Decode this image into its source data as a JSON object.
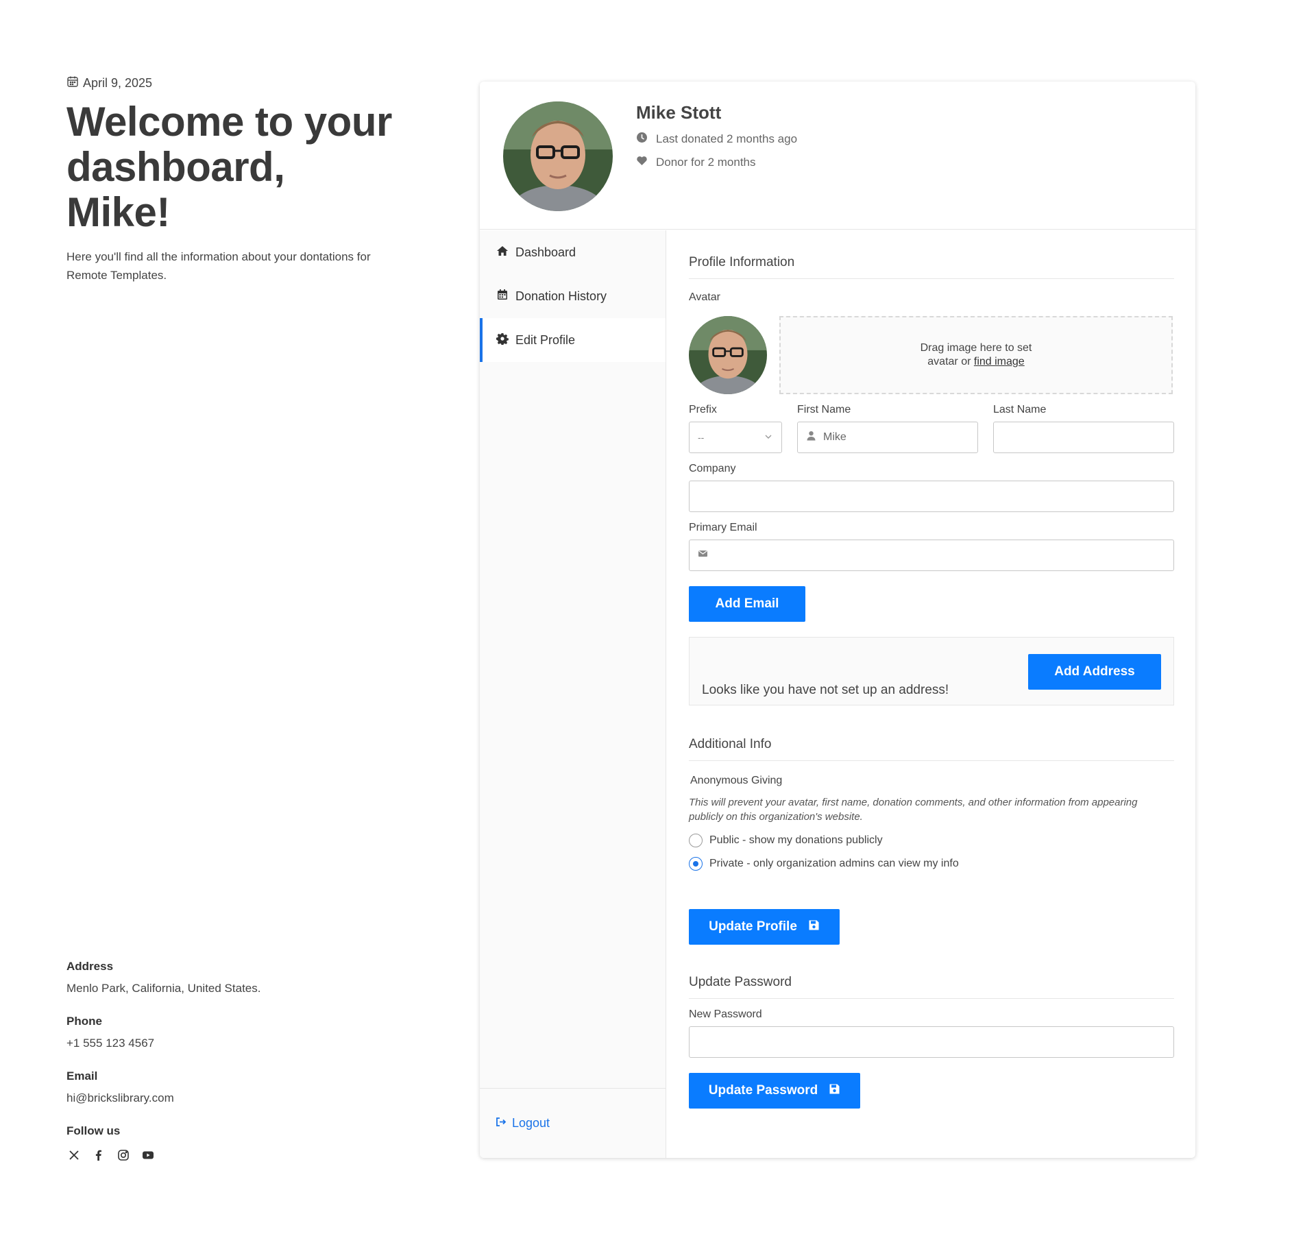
{
  "page": {
    "date": "April 9, 2025",
    "welcome_title": "Welcome to your dashboard, Mike!",
    "intro": "Here you'll find all the information about your dontations for Remote Templates."
  },
  "contact": {
    "address_label": "Address",
    "address_value": "Menlo Park, California, United States.",
    "phone_label": "Phone",
    "phone_value": "+1 555 123 4567",
    "email_label": "Email",
    "email_value": "hi@brickslibrary.com",
    "follow_label": "Follow us",
    "social_icons": [
      "x-icon",
      "facebook-icon",
      "instagram-icon",
      "youtube-icon"
    ]
  },
  "profile_header": {
    "name": "Mike Stott",
    "last_donated": "Last donated 2 months ago",
    "donor_for": "Donor for 2 months"
  },
  "sidebar": {
    "items": [
      {
        "label": "Dashboard",
        "icon": "home-icon",
        "active": false
      },
      {
        "label": "Donation History",
        "icon": "calendar-icon",
        "active": false
      },
      {
        "label": "Edit Profile",
        "icon": "gear-icon",
        "active": true
      }
    ],
    "logout_label": "Logout"
  },
  "profile_info": {
    "section_title": "Profile Information",
    "avatar_label": "Avatar",
    "drop_text": "Drag image here to set",
    "drop_text_2": "avatar or",
    "drop_link": "find image",
    "prefix_label": "Prefix",
    "prefix_value": "--",
    "first_name_label": "First Name",
    "first_name_value": "Mike",
    "last_name_label": "Last Name",
    "last_name_value": "",
    "company_label": "Company",
    "company_value": "",
    "email_label": "Primary Email",
    "email_value": "",
    "add_email_label": "Add Email",
    "no_address_text": "Looks like you have not set up an address!",
    "add_address_label": "Add Address"
  },
  "additional_info": {
    "section_title": "Additional Info",
    "anonymous_label": "Anonymous Giving",
    "anonymous_help": "This will prevent your avatar, first name, donation comments, and other information from appearing publicly on this organization's website.",
    "options": [
      {
        "label": "Public - show my donations publicly",
        "checked": false
      },
      {
        "label": "Private - only organization admins can view my info",
        "checked": true
      }
    ],
    "update_profile_label": "Update Profile"
  },
  "password": {
    "section_title": "Update Password",
    "new_password_label": "New Password",
    "new_password_value": "",
    "update_password_label": "Update Password"
  },
  "colors": {
    "accent": "#0a7cff",
    "text": "#3c3c3c",
    "sidebar_bg": "#fafafa"
  }
}
